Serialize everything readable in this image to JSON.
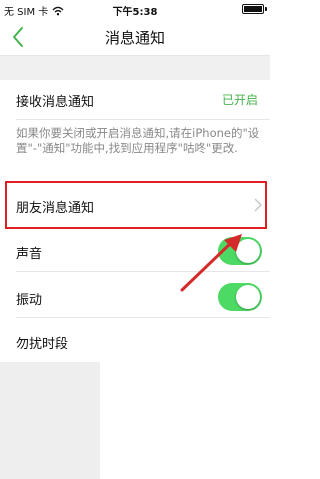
{
  "status_bar": {
    "carrier": "无 SIM 卡",
    "time": "下午5:38"
  },
  "nav": {
    "title": "消息通知"
  },
  "settings": {
    "receive_label": "接收消息通知",
    "receive_value": "已开启",
    "notice": "如果你要关闭或开启消息通知,请在iPhone的\"设置\"-\"通知\"功能中,找到应用程序\"咕咚\"更改.",
    "friend_label": "朋友消息通知",
    "sound_label": "声音",
    "sound_on": true,
    "vibrate_label": "振动",
    "vibrate_on": true,
    "dnd_label": "勿扰时段"
  },
  "colors": {
    "accent_green": "#44b34a",
    "toggle_green": "#4cd964",
    "highlight_red": "#e02020"
  }
}
